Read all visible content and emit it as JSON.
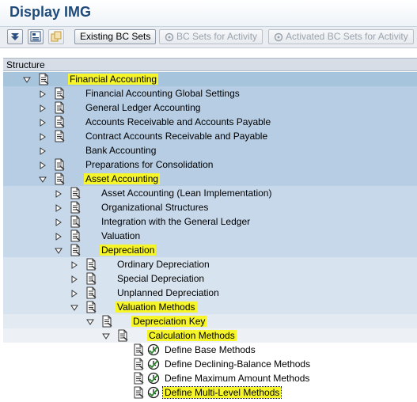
{
  "window": {
    "title": "Display IMG"
  },
  "toolbar": {
    "icon_buttons": [
      {
        "name": "expand-subtree-icon"
      },
      {
        "name": "where-used-icon"
      },
      {
        "name": "find-icon"
      }
    ],
    "existing_bc_sets": "Existing BC Sets",
    "bc_sets_for_activity": "BC Sets for Activity",
    "activated_bc_sets_for_activity": "Activated BC Sets for Activity"
  },
  "tree": {
    "header": "Structure",
    "rows": [
      {
        "label": "Financial Accounting",
        "level": 0,
        "expander": "expanded",
        "icon": "document",
        "highlighted": true
      },
      {
        "label": "Financial Accounting Global Settings",
        "level": 1,
        "expander": "collapsed",
        "icon": "document",
        "highlighted": false
      },
      {
        "label": "General Ledger Accounting",
        "level": 1,
        "expander": "collapsed",
        "icon": "document",
        "highlighted": false
      },
      {
        "label": "Accounts Receivable and Accounts Payable",
        "level": 1,
        "expander": "collapsed",
        "icon": "document",
        "highlighted": false
      },
      {
        "label": "Contract Accounts Receivable and Payable",
        "level": 1,
        "expander": "collapsed",
        "icon": "document",
        "highlighted": false
      },
      {
        "label": "Bank Accounting",
        "level": 1,
        "expander": "collapsed",
        "icon": "none",
        "highlighted": false
      },
      {
        "label": "Preparations for Consolidation",
        "level": 1,
        "expander": "collapsed",
        "icon": "document",
        "highlighted": false
      },
      {
        "label": "Asset Accounting",
        "level": 1,
        "expander": "expanded",
        "icon": "document",
        "highlighted": true
      },
      {
        "label": "Asset Accounting (Lean Implementation)",
        "level": 2,
        "expander": "collapsed",
        "icon": "document",
        "highlighted": false
      },
      {
        "label": "Organizational Structures",
        "level": 2,
        "expander": "collapsed",
        "icon": "document",
        "highlighted": false
      },
      {
        "label": "Integration with the General Ledger",
        "level": 2,
        "expander": "collapsed",
        "icon": "document",
        "highlighted": false
      },
      {
        "label": "Valuation",
        "level": 2,
        "expander": "collapsed",
        "icon": "document",
        "highlighted": false
      },
      {
        "label": "Depreciation",
        "level": 2,
        "expander": "expanded",
        "icon": "document",
        "highlighted": true
      },
      {
        "label": "Ordinary Depreciation",
        "level": 3,
        "expander": "collapsed",
        "icon": "document",
        "highlighted": false
      },
      {
        "label": "Special Depreciation",
        "level": 3,
        "expander": "collapsed",
        "icon": "document",
        "highlighted": false
      },
      {
        "label": "Unplanned Depreciation",
        "level": 3,
        "expander": "collapsed",
        "icon": "document",
        "highlighted": false
      },
      {
        "label": "Valuation Methods",
        "level": 3,
        "expander": "expanded",
        "icon": "document",
        "highlighted": true
      },
      {
        "label": "Depreciation Key",
        "level": 4,
        "expander": "expanded",
        "icon": "document",
        "highlighted": true
      },
      {
        "label": "Calculation Methods",
        "level": 5,
        "expander": "expanded",
        "icon": "document",
        "highlighted": true
      },
      {
        "label": "Define Base Methods",
        "level": 6,
        "expander": "none",
        "icon": "activity",
        "highlighted": false
      },
      {
        "label": "Define Declining-Balance Methods",
        "level": 6,
        "expander": "none",
        "icon": "activity",
        "highlighted": false
      },
      {
        "label": "Define Maximum Amount Methods",
        "level": 6,
        "expander": "none",
        "icon": "activity",
        "highlighted": false
      },
      {
        "label": "Define Multi-Level Methods",
        "level": 6,
        "expander": "none",
        "icon": "activity",
        "highlighted": true,
        "selected": true
      }
    ]
  }
}
